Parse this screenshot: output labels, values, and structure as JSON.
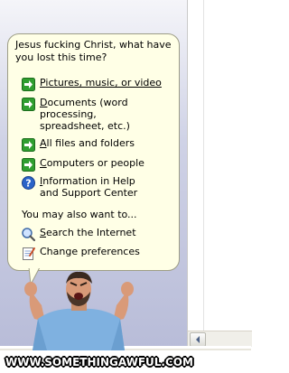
{
  "assistant": {
    "title": "Jesus fucking Christ, what have you lost this time?",
    "options": [
      {
        "label_underlined": "P",
        "label_rest": "ictures, music, or video",
        "icon": "green-arrow-icon"
      },
      {
        "label_underlined": "D",
        "label_rest": "ocuments (word processing, spreadsheet, etc.)",
        "icon": "green-arrow-icon"
      },
      {
        "label_underlined": "A",
        "label_rest": "ll files and folders",
        "icon": "green-arrow-icon"
      },
      {
        "label_underlined": "C",
        "label_rest": "omputers or people",
        "icon": "green-arrow-icon"
      },
      {
        "label_underlined": "I",
        "label_rest": "nformation in Help and Support Center",
        "icon": "help-icon"
      }
    ],
    "also_label": "You may also want to...",
    "more_options": [
      {
        "label_underlined": "S",
        "label_rest": "earch the Internet",
        "icon": "search-internet-icon"
      },
      {
        "label_underlined": "",
        "label_rest": "Change preferences",
        "icon": "preferences-icon"
      }
    ]
  },
  "watermark": "WWW.SOMETHINGAWFUL.COM",
  "colors": {
    "balloon": "#ffffe6",
    "arrow_green": "#2f9e2f",
    "pane_gradient_top": "#f5f5f9",
    "pane_gradient_bottom": "#b8bcd8"
  }
}
